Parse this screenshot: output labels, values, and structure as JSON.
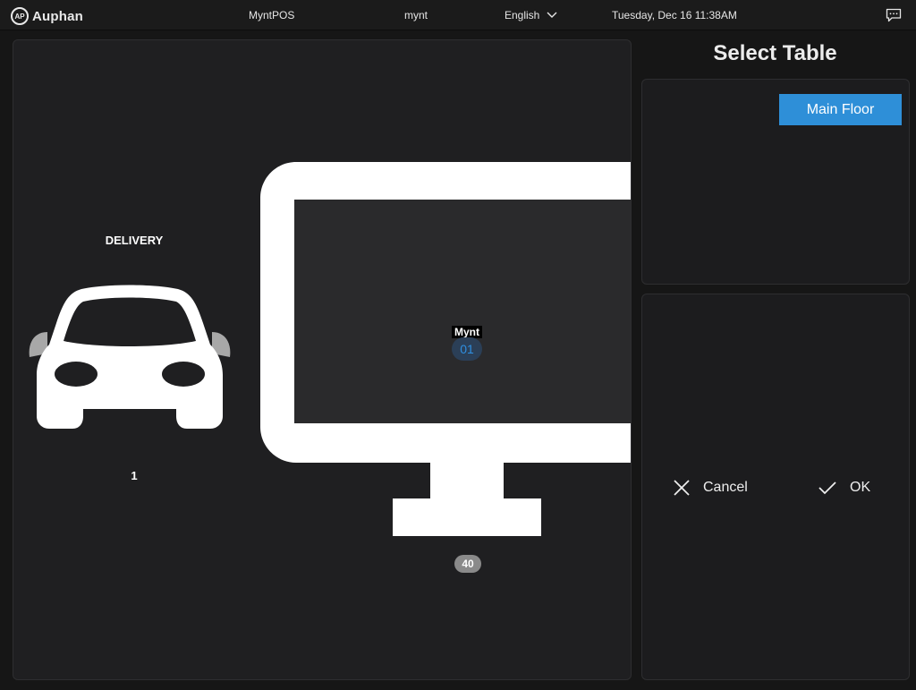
{
  "header": {
    "logo_text": "Auphan",
    "logo_mark": "AP",
    "app_name": "MyntPOS",
    "user": "mynt",
    "language": "English",
    "datetime": "Tuesday, Dec 16 11:38AM"
  },
  "floor": {
    "delivery": {
      "label": "DELIVERY",
      "count": "1",
      "icon": "car-icon"
    },
    "table": {
      "name": "Mynt",
      "number": "01",
      "seats": "40",
      "icon": "monitor-icon"
    }
  },
  "sidebar": {
    "title": "Select Table",
    "areas": [
      {
        "label": "Main Floor",
        "selected": true
      }
    ],
    "cancel_label": "Cancel",
    "ok_label": "OK"
  },
  "colors": {
    "accent": "#2e8fd8",
    "background": "#161616",
    "panel": "#1f1f21",
    "table_number": "#2f8fe0"
  }
}
